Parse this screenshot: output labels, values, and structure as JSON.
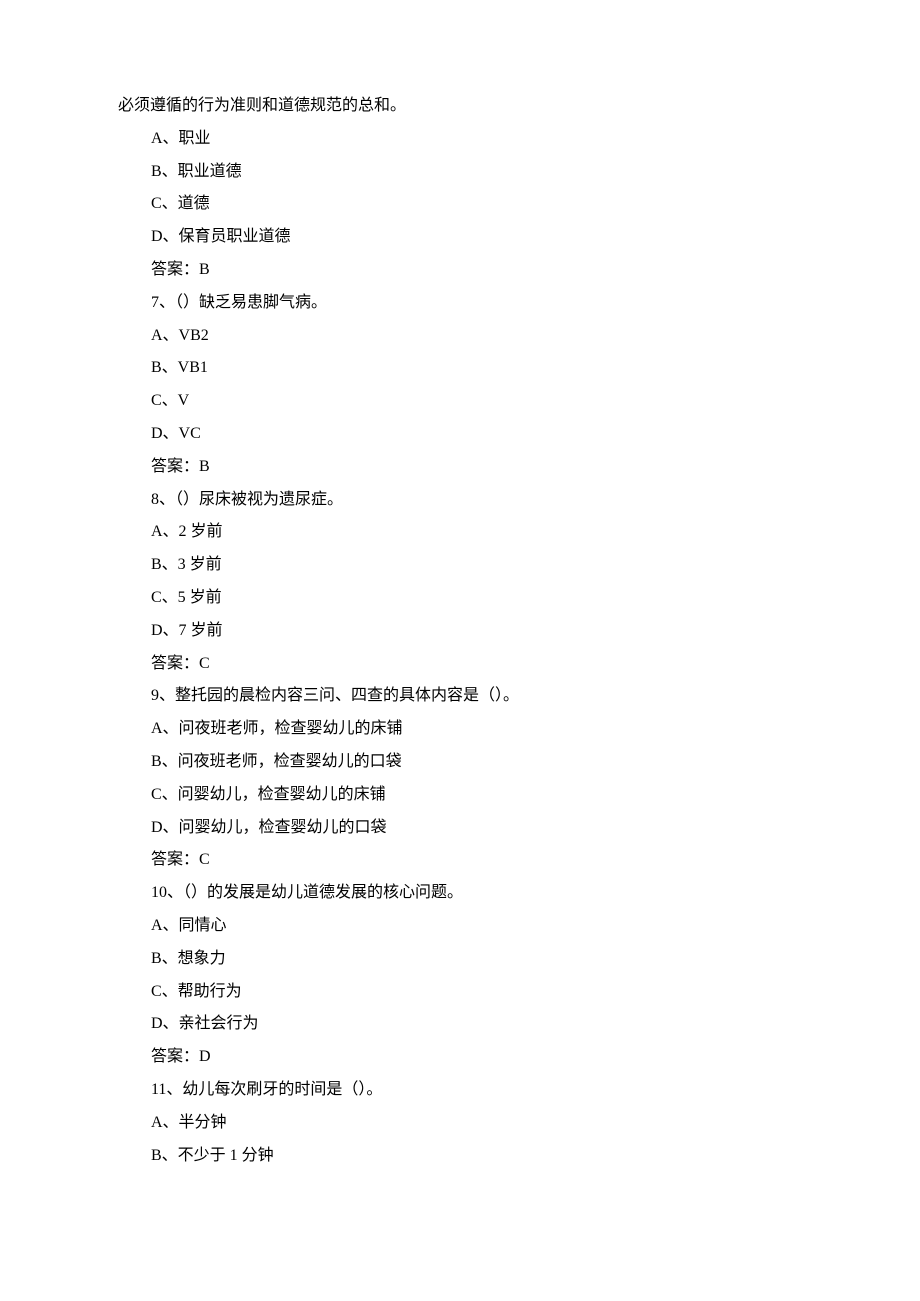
{
  "intro_line": "必须遵循的行为准则和道德规范的总和。",
  "q6": {
    "A": "A、职业",
    "B": "B、职业道德",
    "C": "C、道德",
    "D": "D、保育员职业道德",
    "answer": "答案：B"
  },
  "q7": {
    "stem": "7、（）缺乏易患脚气病。",
    "A": "A、VB2",
    "B": "B、VB1",
    "C": "C、V",
    "D": "D、VC",
    "answer": "答案：B"
  },
  "q8": {
    "stem": "8、（）尿床被视为遗尿症。",
    "A": "A、2 岁前",
    "B": "B、3 岁前",
    "C": "C、5 岁前",
    "D": "D、7 岁前",
    "answer": "答案：C"
  },
  "q9": {
    "stem": "9、整托园的晨检内容三问、四查的具体内容是（）。",
    "A": "A、问夜班老师，检查婴幼儿的床铺",
    "B": "B、问夜班老师，检查婴幼儿的口袋",
    "C": "C、问婴幼儿，检查婴幼儿的床铺",
    "D": "D、问婴幼儿，检查婴幼儿的口袋",
    "answer": "答案：C"
  },
  "q10": {
    "stem": "10、（）的发展是幼儿道德发展的核心问题。",
    "A": "A、同情心",
    "B": "B、想象力",
    "C": "C、帮助行为",
    "D": "D、亲社会行为",
    "answer": "答案：D"
  },
  "q11": {
    "stem": "11、幼儿每次刷牙的时间是（）。",
    "A": "A、半分钟",
    "B": "B、不少于 1 分钟"
  }
}
